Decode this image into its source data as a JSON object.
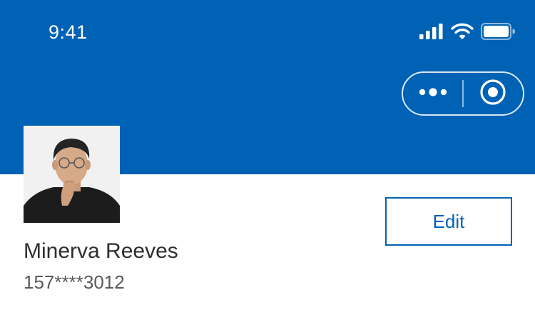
{
  "status_bar": {
    "time": "9:41",
    "icons": [
      "signal-icon",
      "wifi-icon",
      "battery-icon"
    ]
  },
  "header": {
    "background_color": "#0062B4",
    "capsule": {
      "more_icon": "more-dots-icon",
      "close_icon": "target-circle-icon"
    }
  },
  "profile": {
    "avatar": "user-avatar-photo",
    "name": "Minerva Reeves",
    "phone": "157****3012",
    "edit_label": "Edit"
  },
  "colors": {
    "accent": "#0062B4",
    "name_text": "#2e2e2e",
    "phone_text": "#5a5a5a"
  }
}
